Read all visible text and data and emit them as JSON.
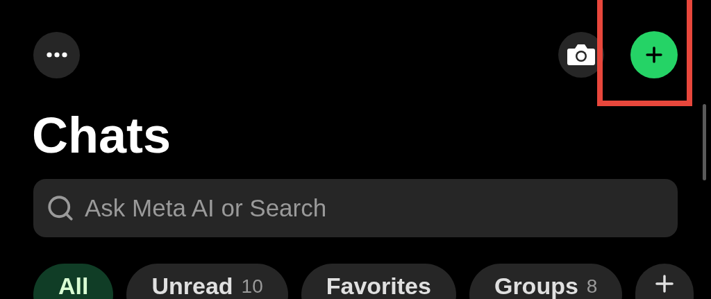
{
  "title": "Chats",
  "search": {
    "placeholder": "Ask Meta AI or Search"
  },
  "filters": [
    {
      "label": "All",
      "selected": true
    },
    {
      "label": "Unread",
      "count": "10",
      "selected": false
    },
    {
      "label": "Favorites",
      "selected": false
    },
    {
      "label": "Groups",
      "count": "8",
      "selected": false
    }
  ]
}
